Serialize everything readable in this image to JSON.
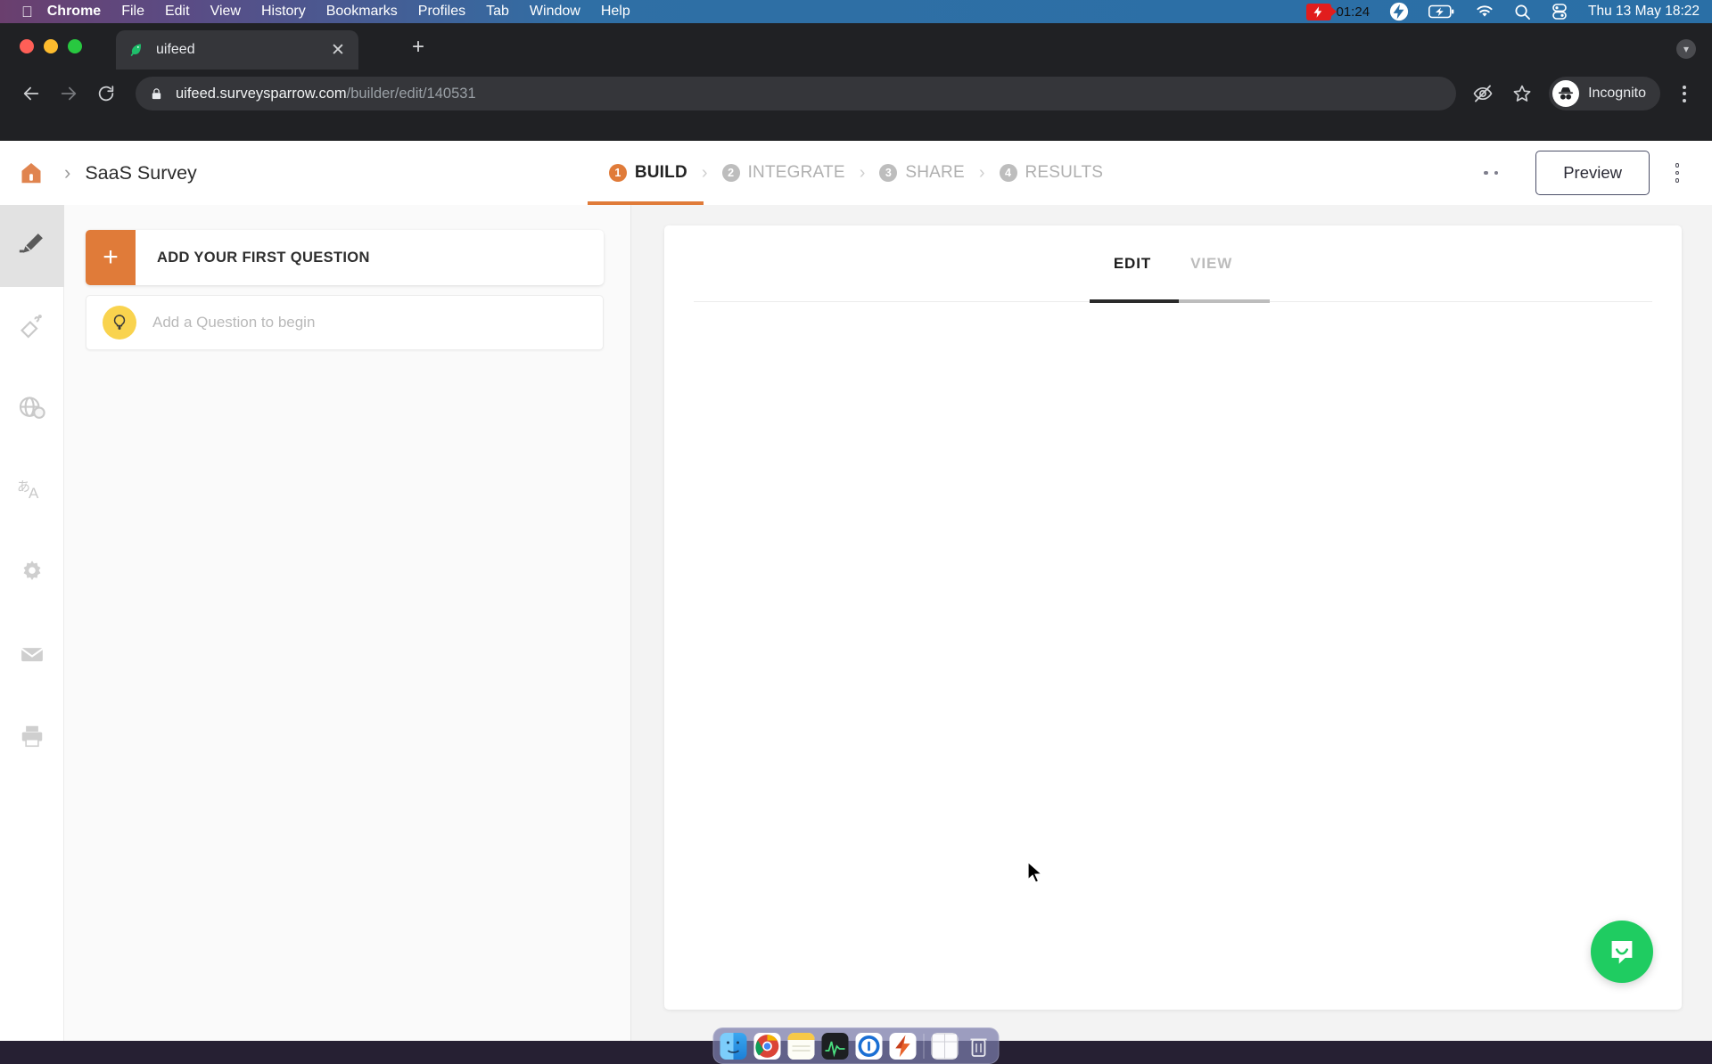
{
  "menubar": {
    "apple_icon": "apple-logo-icon",
    "items": [
      {
        "label": "Chrome",
        "bold": true
      },
      {
        "label": "File",
        "bold": false
      },
      {
        "label": "Edit",
        "bold": false
      },
      {
        "label": "View",
        "bold": false
      },
      {
        "label": "History",
        "bold": false
      },
      {
        "label": "Bookmarks",
        "bold": false
      },
      {
        "label": "Profiles",
        "bold": false
      },
      {
        "label": "Tab",
        "bold": false
      },
      {
        "label": "Window",
        "bold": false
      },
      {
        "label": "Help",
        "bold": false
      }
    ],
    "status": {
      "recording_time": "01:24",
      "recording_icon": "screen-recording-icon",
      "bolt_icon": "flash-icon",
      "battery_icon": "battery-charging-icon",
      "wifi_icon": "wifi-icon",
      "search_icon": "spotlight-search-icon",
      "control_center_icon": "control-center-icon",
      "datetime": "Thu 13 May  18:22"
    }
  },
  "browser": {
    "tab": {
      "title": "uifeed",
      "favicon": "surveysparrow-favicon",
      "close_icon": "close-icon"
    },
    "new_tab_label": "+",
    "nav": {
      "back_icon": "arrow-left-icon",
      "forward_icon": "arrow-right-icon",
      "reload_icon": "reload-icon"
    },
    "omnibox": {
      "lock_icon": "lock-icon",
      "url_host": "uifeed.surveysparrow.com",
      "url_path": "/builder/edit/140531"
    },
    "toolbar_right": {
      "eye_slash_icon": "eye-slash-icon",
      "bookmark_icon": "star-icon",
      "profile_label": "Incognito",
      "profile_icon": "incognito-icon",
      "menu_icon": "three-dot-menu-icon"
    }
  },
  "app": {
    "breadcrumb": {
      "home_icon": "home-icon",
      "separator": "›",
      "survey_name": "SaaS Survey"
    },
    "steps": [
      {
        "num": "1",
        "label": "BUILD",
        "active": true
      },
      {
        "num": "2",
        "label": "INTEGRATE",
        "active": false
      },
      {
        "num": "3",
        "label": "SHARE",
        "active": false
      },
      {
        "num": "4",
        "label": "RESULTS",
        "active": false
      }
    ],
    "step_separator": "›",
    "header_actions": {
      "more_dots_icon": "two-dot-icon",
      "preview_label": "Preview",
      "kebab_icon": "vertical-three-dot-icon"
    },
    "rail": [
      {
        "icon": "pencil-edit-icon",
        "active": true
      },
      {
        "icon": "paint-brush-theme-icon",
        "active": false
      },
      {
        "icon": "globe-share-icon",
        "active": false
      },
      {
        "icon": "translate-language-icon",
        "active": false
      },
      {
        "icon": "gear-settings-icon",
        "active": false
      },
      {
        "icon": "envelope-mail-icon",
        "active": false
      },
      {
        "icon": "printer-icon",
        "active": false
      }
    ],
    "left_panel": {
      "add_first_question": {
        "plus_icon": "plus-icon",
        "label": "ADD YOUR FIRST QUESTION"
      },
      "hint": {
        "bulb_icon": "lightbulb-icon",
        "text": "Add a Question to begin"
      }
    },
    "canvas": {
      "tabs": [
        {
          "label": "EDIT",
          "active": true
        },
        {
          "label": "VIEW",
          "active": false
        }
      ]
    },
    "intercom_icon": "intercom-chat-icon",
    "accent_color": "#e07b39",
    "intercom_color": "#1fcc61"
  },
  "dock": {
    "items": [
      {
        "name": "finder",
        "running": true
      },
      {
        "name": "google-chrome",
        "running": true
      },
      {
        "name": "notes",
        "running": true
      },
      {
        "name": "activity-monitor",
        "running": true
      },
      {
        "name": "1password",
        "running": true
      },
      {
        "name": "flash-app",
        "running": true
      },
      {
        "name": "downloads-stack",
        "running": false
      },
      {
        "name": "trash",
        "running": false
      }
    ]
  }
}
